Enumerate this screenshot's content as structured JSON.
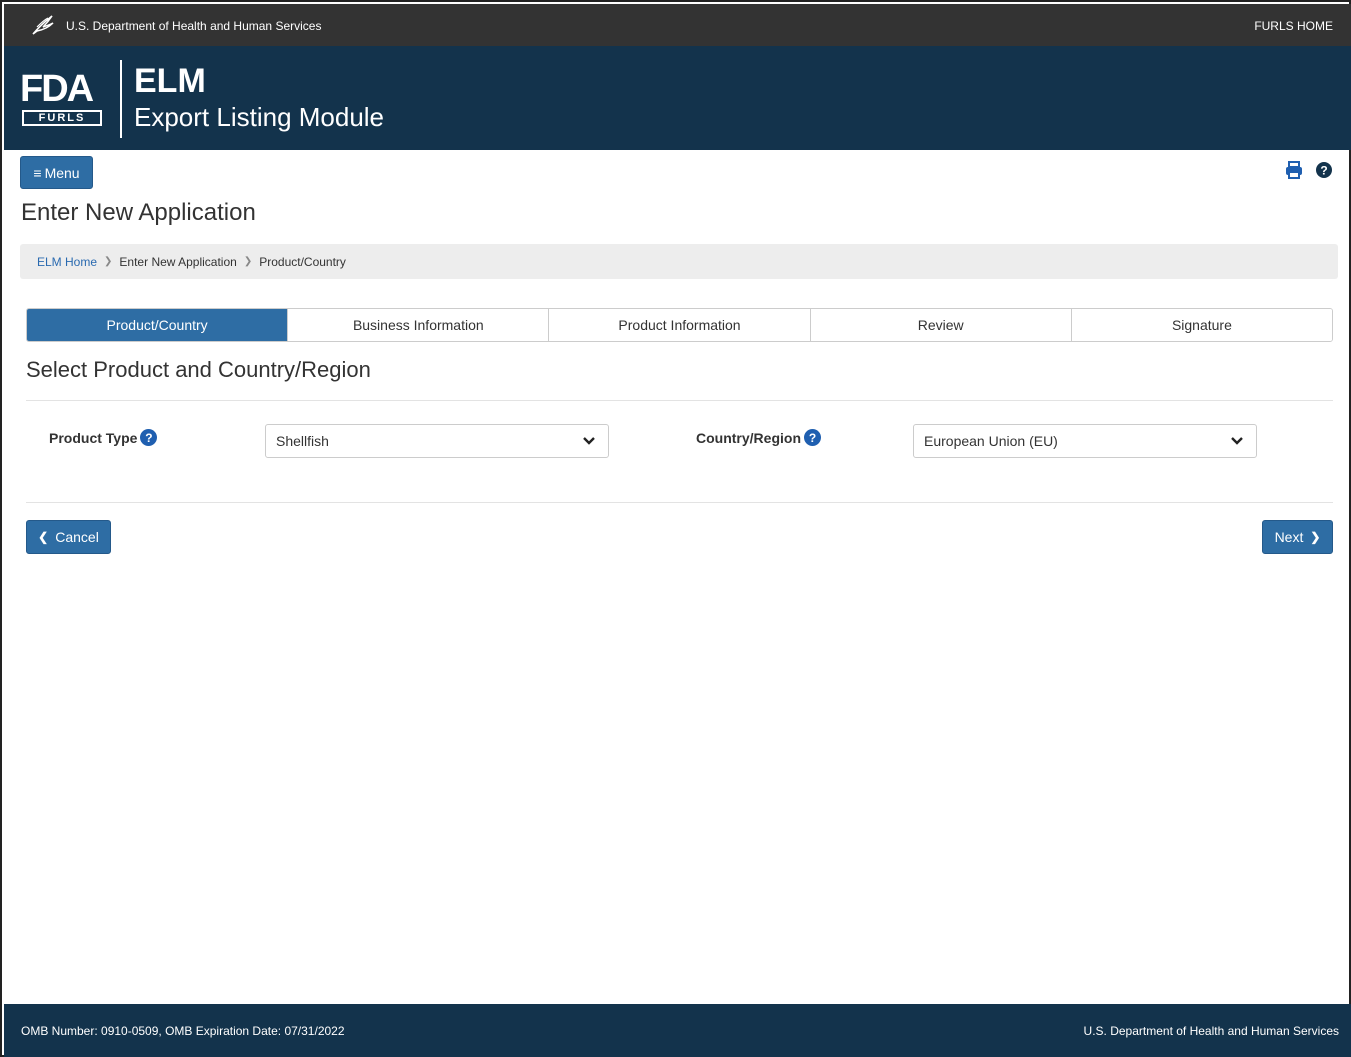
{
  "topbar": {
    "agency": "U.S. Department of Health and Human Services",
    "home_link": "FURLS HOME"
  },
  "banner": {
    "logo_text": "FDA",
    "logo_subtext": "FURLS",
    "app_abbr": "ELM",
    "app_name": "Export Listing Module"
  },
  "toolbar": {
    "menu_label": "Menu",
    "icons": [
      "print-icon",
      "help-icon"
    ]
  },
  "page": {
    "title": "Enter New Application"
  },
  "breadcrumb": [
    "ELM Home",
    "Enter New Application",
    "Product/Country"
  ],
  "wizard": {
    "steps": [
      "Product/Country",
      "Business Information",
      "Product Information",
      "Review",
      "Signature"
    ],
    "active_step": "Product/Country"
  },
  "form": {
    "section_title": "Select Product and Country/Region",
    "product_type": {
      "label": "Product Type",
      "value": "Shellfish"
    },
    "country_region": {
      "label": "Country/Region",
      "value": "European Union (EU)"
    }
  },
  "actions": {
    "cancel_label": "Cancel",
    "next_label": "Next"
  },
  "footer": {
    "omb_text": "OMB Number: 0910-0509, OMB Expiration Date: 07/31/2022",
    "agency": "U.S. Department of Health and Human Services"
  },
  "colors": {
    "banner": "#13334c",
    "topbar": "#333333",
    "primary": "#2e6da4",
    "link": "#2a6ab0",
    "help_icon": "#1f5fb0"
  }
}
